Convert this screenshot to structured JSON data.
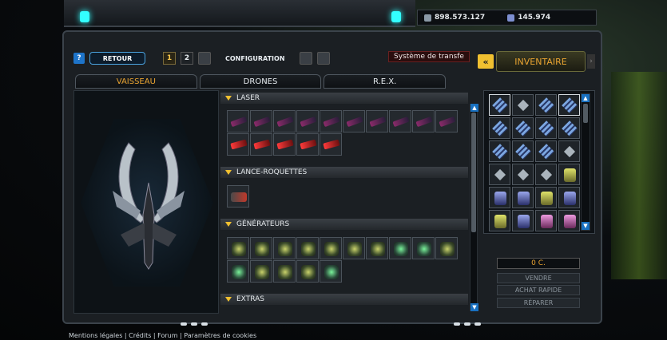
{
  "currency": {
    "credits": "898.573.127",
    "uridium": "145.974"
  },
  "toolbar": {
    "help_label": "?",
    "back_label": "RETOUR",
    "config_1": "1",
    "config_2": "2",
    "config_label": "CONFIGURATION",
    "system_text": "Système de transfe"
  },
  "tabs": [
    {
      "label": "VAISSEAU"
    },
    {
      "label": "DRONES"
    },
    {
      "label": "R.E.X."
    }
  ],
  "categories": {
    "laser": "LASER",
    "rockets": "LANCE-ROQUETTES",
    "generators": "GÉNÉRATEURS",
    "extras": "EXTRAS"
  },
  "inventory": {
    "arrow_label": "«",
    "title": "INVENTAIRE",
    "price": "0 C.",
    "sell": "VENDRE",
    "quick_buy": "ACHAT RAPIDE",
    "repair": "RÉPARER"
  },
  "footer": {
    "text": "Mentions légales | Crédits | Forum | Paramètres de cookies"
  },
  "colors": {
    "accent": "#e8a331",
    "highlight": "#f0c030",
    "button_blue": "#1870c0"
  }
}
